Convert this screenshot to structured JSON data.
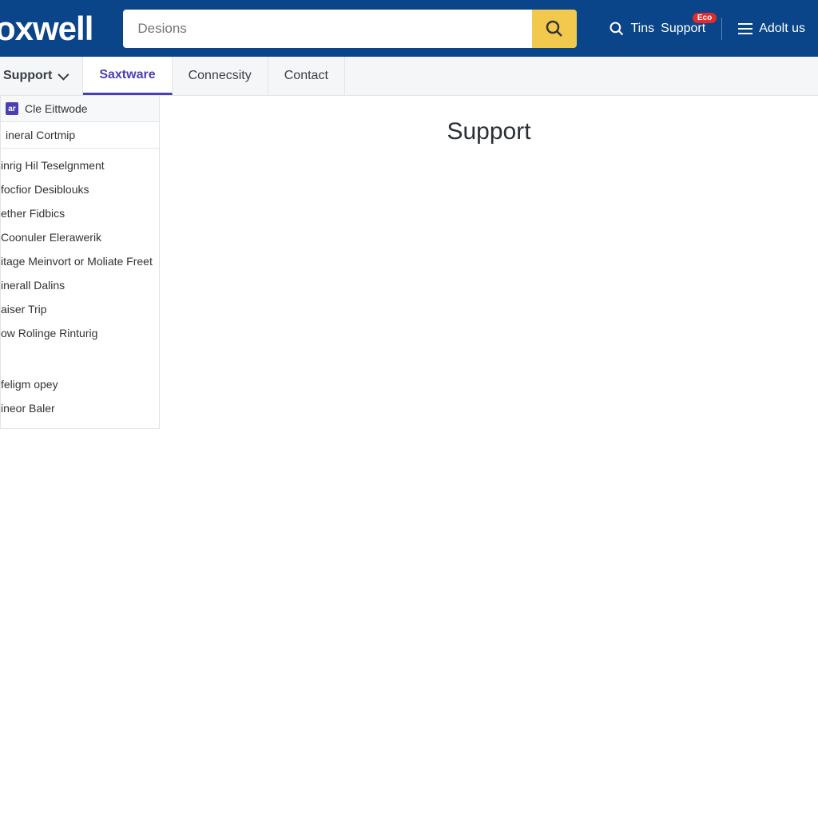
{
  "header": {
    "logo_text": "oxwell",
    "search_placeholder": "Desions",
    "tins_label": "Tins",
    "support_label": "Support",
    "badge_text": "Eco",
    "about_label": "Adolt us"
  },
  "navbar": {
    "items": [
      {
        "label": "Support",
        "dropdown": true,
        "active": false
      },
      {
        "label": "Saxtware",
        "dropdown": false,
        "active": true
      },
      {
        "label": "Connecsity",
        "dropdown": false,
        "active": false
      },
      {
        "label": "Contact",
        "dropdown": false,
        "active": false
      }
    ]
  },
  "sidebar": {
    "header_badge": "ar",
    "header_label": "Cle Eittwode",
    "group_label": "ineral Cortmip",
    "items_a": [
      "inrig Hil Teselgnment",
      "focfior Desiblouks",
      "ether Fidbics",
      "Coonuler Elerawerik",
      "itage Meinvort or Moliate Freet",
      "inerall Dalins",
      "aiser Trip",
      "ow Rolinge Rinturig"
    ],
    "items_b": [
      "feligm opey",
      "ineor Baler"
    ]
  },
  "main": {
    "title": "Support"
  }
}
